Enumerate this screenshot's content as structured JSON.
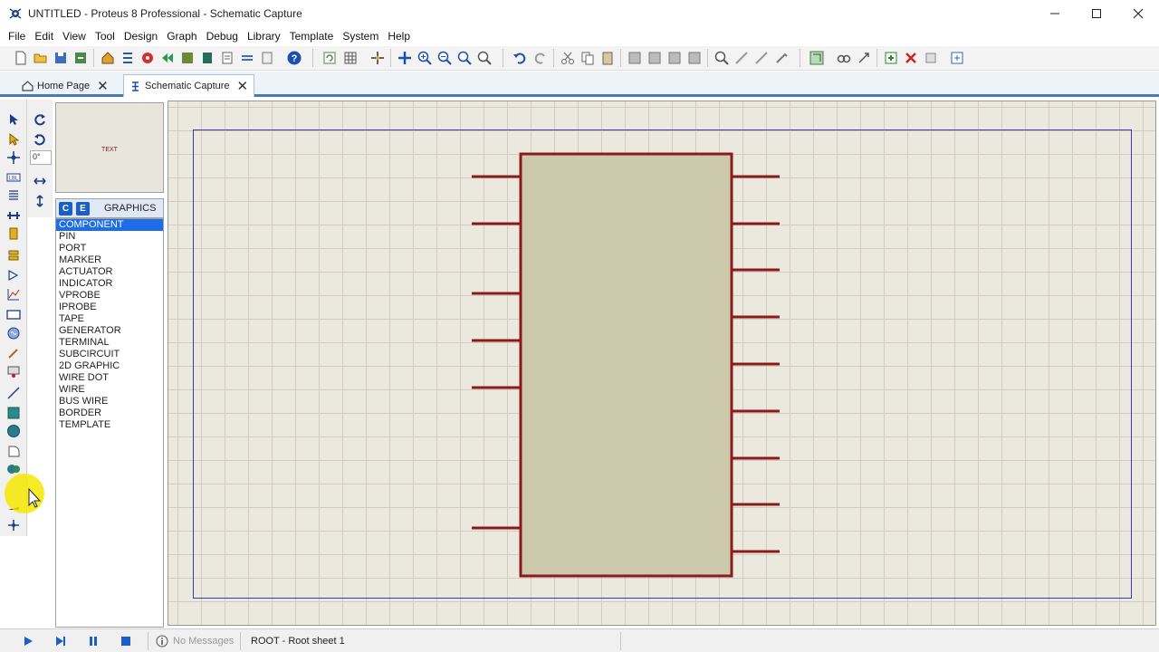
{
  "window": {
    "title": "UNTITLED - Proteus 8 Professional - Schematic Capture"
  },
  "menu": [
    "File",
    "Edit",
    "View",
    "Tool",
    "Design",
    "Graph",
    "Debug",
    "Library",
    "Template",
    "System",
    "Help"
  ],
  "tabs": [
    {
      "label": "Home Page",
      "active": false
    },
    {
      "label": "Schematic Capture",
      "active": true
    }
  ],
  "preview": {
    "text": "TEXT"
  },
  "rotation": {
    "value": "0°"
  },
  "panel": {
    "btn_c": "C",
    "btn_e": "E",
    "title": "GRAPHICS"
  },
  "object_list": {
    "items": [
      "COMPONENT",
      "PIN",
      "PORT",
      "MARKER",
      "ACTUATOR",
      "INDICATOR",
      "VPROBE",
      "IPROBE",
      "TAPE",
      "GENERATOR",
      "TERMINAL",
      "SUBCIRCUIT",
      "2D GRAPHIC",
      "WIRE DOT",
      "WIRE",
      "BUS WIRE",
      "BORDER",
      "TEMPLATE"
    ],
    "selected": "COMPONENT"
  },
  "status": {
    "messages": "No Messages",
    "sheet": "ROOT - Root sheet 1"
  },
  "colors": {
    "accent": "#1d6de8",
    "chip_outline": "#8b1a1a",
    "chip_fill": "#cdc9ad",
    "sheet_border": "#3b3bb0",
    "canvas_bg": "#ebe8de"
  },
  "component": {
    "left_pins": 6,
    "right_pins": 9
  }
}
